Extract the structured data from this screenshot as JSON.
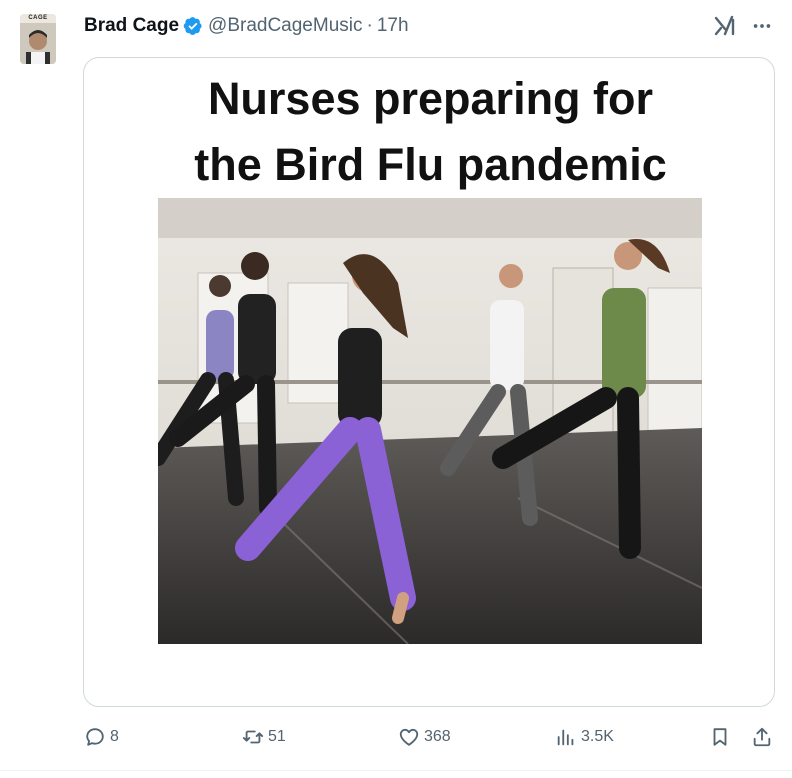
{
  "tweet": {
    "author_name": "Brad Cage",
    "handle": "@BradCageMusic",
    "separator": "·",
    "time": "17h",
    "avatar_caption": "CAGE",
    "image_caption_line1": "Nurses preparing for",
    "image_caption_line2": "the Bird Flu pandemic"
  },
  "actions": {
    "replies": "8",
    "retweets": "51",
    "likes": "368",
    "views": "3.5K"
  },
  "colors": {
    "verified_badge": "#1d9bf0",
    "secondary_text": "#536471",
    "border": "#cfd9de"
  },
  "icons": {
    "more": "more-icon",
    "grok": "grok-icon",
    "reply": "reply-icon",
    "retweet": "retweet-icon",
    "like": "like-icon",
    "views": "views-icon",
    "bookmark": "bookmark-icon",
    "share": "share-icon"
  }
}
